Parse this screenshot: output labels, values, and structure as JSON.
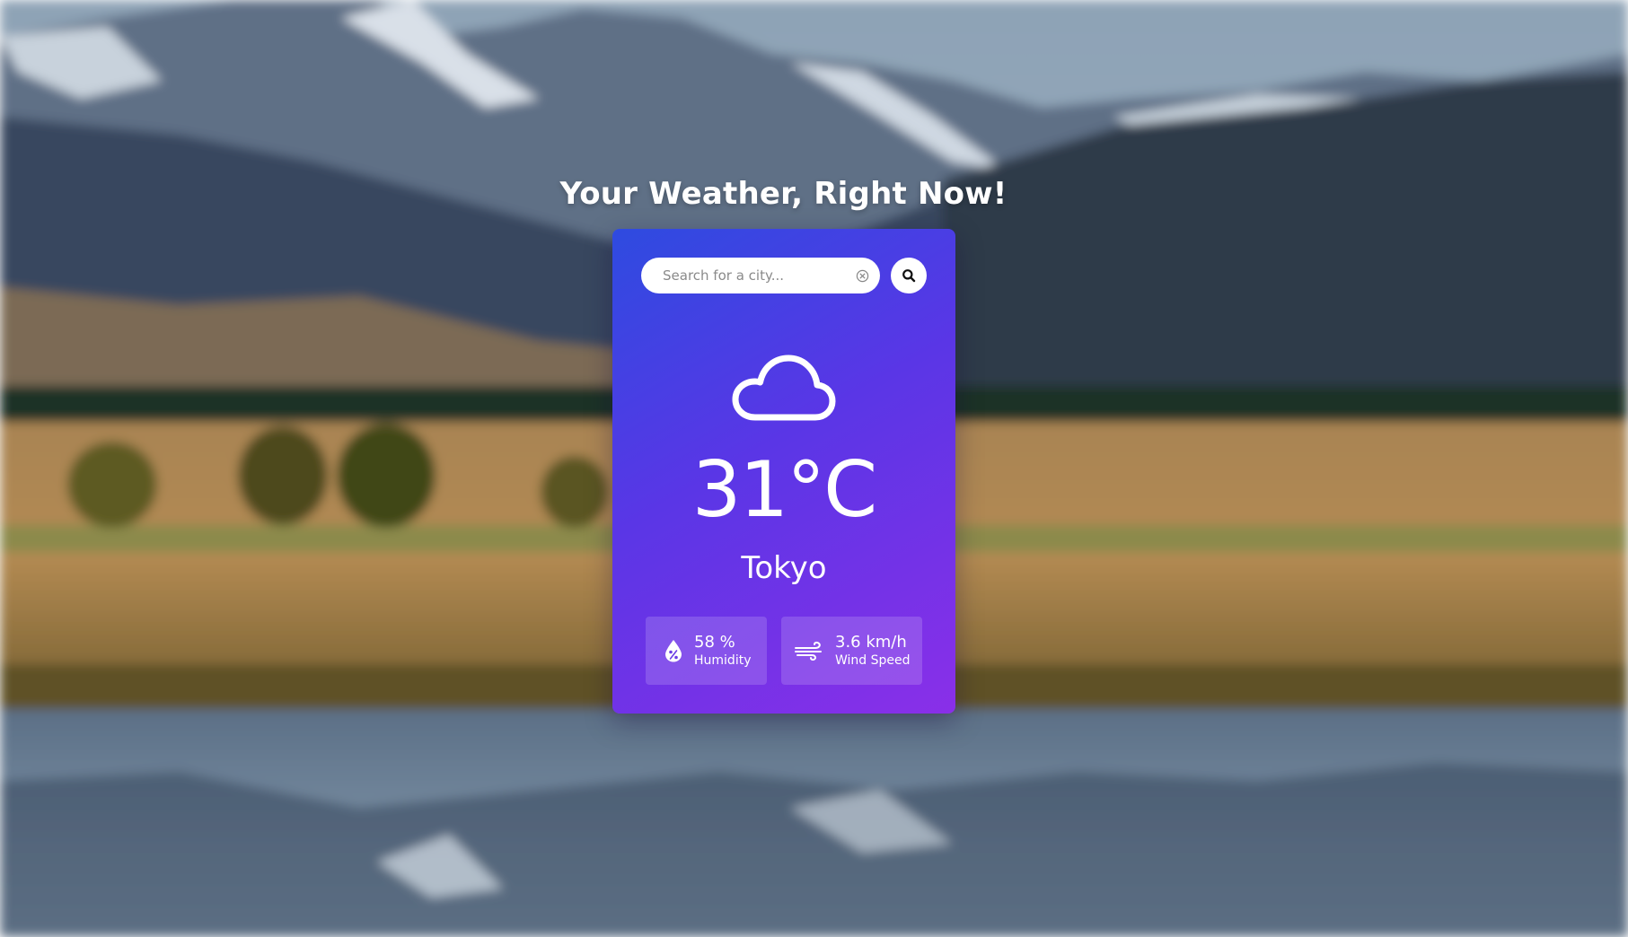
{
  "header": {
    "title": "Your Weather, Right Now!"
  },
  "search": {
    "placeholder": "Search for a city...",
    "value": ""
  },
  "weather": {
    "condition_icon": "cloud-icon",
    "temperature": "31°C",
    "city": "Tokyo"
  },
  "stats": {
    "humidity": {
      "icon": "humidity-drop-icon",
      "value": "58 %",
      "label": "Humidity"
    },
    "wind": {
      "icon": "wind-icon",
      "value": "3.6 km/h",
      "label": "Wind Speed"
    }
  },
  "colors": {
    "card_gradient_start": "#2e4be0",
    "card_gradient_end": "#8a2fe8",
    "text": "#ffffff",
    "search_background": "#ffffff"
  }
}
